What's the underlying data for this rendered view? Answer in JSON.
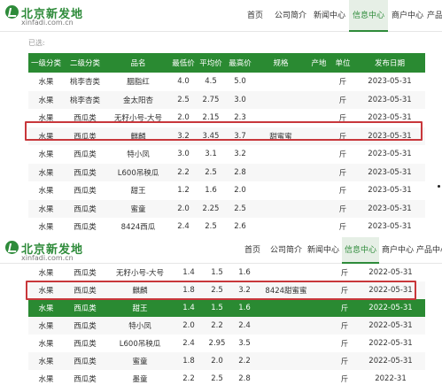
{
  "site": {
    "name": "北京新发地",
    "url": "xinfadi.com.cn"
  },
  "nav": {
    "top1": [
      "首页",
      "公司简介",
      "新闻中心",
      "信息中心",
      "商户中心",
      "产品中心"
    ],
    "top2": [
      "首页",
      "公司简介",
      "新闻中心",
      "信息中心",
      "商户中心",
      "产品中心"
    ]
  },
  "breadcrumb": "已选:",
  "table1": {
    "headers": [
      "一级分类",
      "二级分类",
      "品名",
      "最低价",
      "平均价",
      "最高价",
      "规格",
      "产地",
      "单位",
      "发布日期"
    ],
    "rows": [
      [
        "水果",
        "桃李杏类",
        "胭脂红",
        "4.0",
        "4.5",
        "5.0",
        "",
        "",
        "斤",
        "2023-05-31"
      ],
      [
        "水果",
        "桃李杏类",
        "金太阳杏",
        "2.5",
        "2.75",
        "3.0",
        "",
        "",
        "斤",
        "2023-05-31"
      ],
      [
        "水果",
        "西瓜类",
        "无籽小号-大号",
        "2.0",
        "2.15",
        "2.3",
        "",
        "",
        "斤",
        "2023-05-31"
      ],
      [
        "水果",
        "西瓜类",
        "麒麟",
        "3.2",
        "3.45",
        "3.7",
        "甜蜜蜜",
        "",
        "斤",
        "2023-05-31"
      ],
      [
        "水果",
        "西瓜类",
        "特小凤",
        "3.0",
        "3.1",
        "3.2",
        "",
        "",
        "斤",
        "2023-05-31"
      ],
      [
        "水果",
        "西瓜类",
        "L600吊秧瓜",
        "2.2",
        "2.5",
        "2.8",
        "",
        "",
        "斤",
        "2023-05-31"
      ],
      [
        "水果",
        "西瓜类",
        "甜王",
        "1.2",
        "1.6",
        "2.0",
        "",
        "",
        "斤",
        "2023-05-31"
      ],
      [
        "水果",
        "西瓜类",
        "蜜童",
        "2.0",
        "2.25",
        "2.5",
        "",
        "",
        "斤",
        "2023-05-31"
      ],
      [
        "水果",
        "西瓜类",
        "8424西瓜",
        "2.4",
        "2.5",
        "2.6",
        "",
        "",
        "斤",
        "2023-05-31"
      ]
    ]
  },
  "table2": {
    "rows": [
      [
        "水果",
        "西瓜类",
        "无籽小号-大号",
        "1.4",
        "1.5",
        "1.6",
        "",
        "",
        "斤",
        "2022-05-31"
      ],
      [
        "水果",
        "西瓜类",
        "麒麟",
        "1.8",
        "2.5",
        "3.2",
        "8424甜蜜蜜",
        "",
        "斤",
        "2022-05-31"
      ],
      [
        "水果",
        "西瓜类",
        "甜王",
        "1.4",
        "1.5",
        "1.6",
        "",
        "",
        "斤",
        "2022-05-31"
      ],
      [
        "水果",
        "西瓜类",
        "特小凤",
        "2.0",
        "2.2",
        "2.4",
        "",
        "",
        "斤",
        "2022-05-31"
      ],
      [
        "水果",
        "西瓜类",
        "L600吊秧瓜",
        "2.4",
        "2.95",
        "3.5",
        "",
        "",
        "斤",
        "2022-05-31"
      ],
      [
        "水果",
        "西瓜类",
        "蜜童",
        "1.8",
        "2.0",
        "2.2",
        "",
        "",
        "斤",
        "2022-05-31"
      ],
      [
        "水果",
        "西瓜类",
        "墨童",
        "2.2",
        "2.5",
        "2.8",
        "",
        "",
        "斤",
        "2022-31"
      ]
    ]
  },
  "colors": {
    "brand": "#2e8b3a",
    "header": "#2a8a32",
    "highlight": "#c8373b"
  }
}
